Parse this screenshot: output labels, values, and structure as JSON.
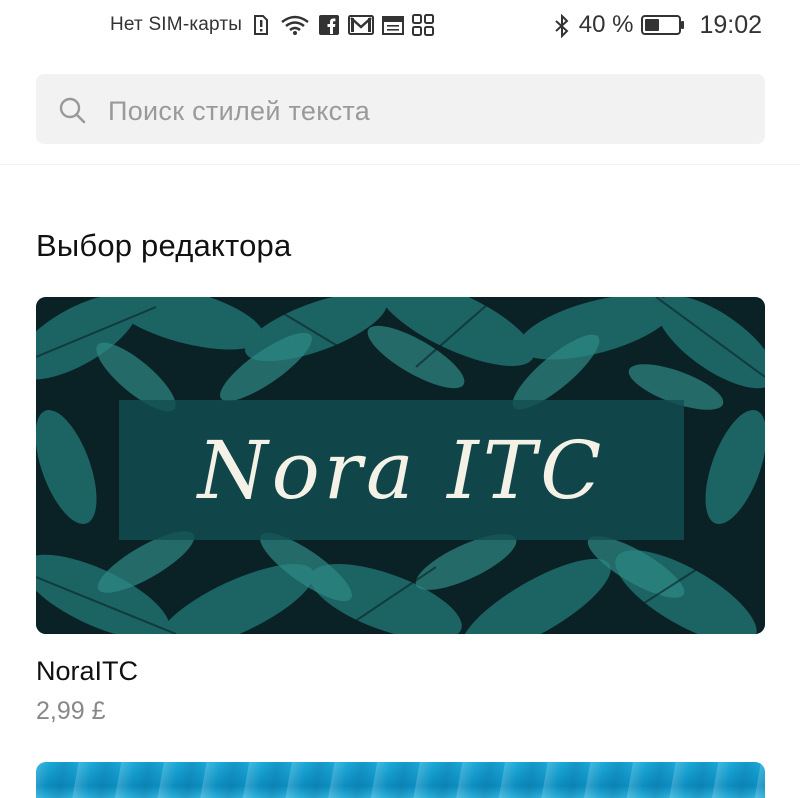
{
  "status_bar": {
    "carrier": "Нет SIM-карты",
    "battery_percent": "40 %",
    "time": "19:02",
    "icons": [
      "sim-alert-icon",
      "wifi-icon",
      "facebook-icon",
      "gmail-icon",
      "calendar-icon",
      "apps-icon",
      "bluetooth-icon",
      "battery-icon"
    ]
  },
  "search": {
    "placeholder": "Поиск стилей текста"
  },
  "editors_choice": {
    "title": "Выбор редактора",
    "items": [
      {
        "banner_text": "Nora ITC",
        "name": "NoraITC",
        "price": "2,99 £"
      }
    ]
  },
  "colors": {
    "search_bg": "#f2f2f2",
    "placeholder": "#9a9a9a",
    "price": "#888888",
    "banner_bg": "#0b2a2e",
    "banner_panel": "#124e52"
  }
}
